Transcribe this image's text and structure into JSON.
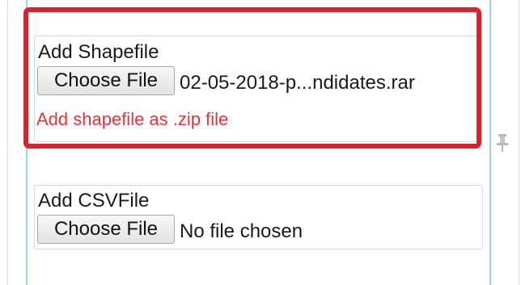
{
  "shapefile": {
    "label": "Add Shapefile",
    "button_label": "Choose File",
    "file_name": "02-05-2018-p...ndidates.rar",
    "hint": "Add shapefile as .zip file"
  },
  "csvfile": {
    "label": "Add CSVFile",
    "button_label": "Choose File",
    "file_name": "No file chosen"
  },
  "colors": {
    "highlight": "#d9222a",
    "hint": "#e8323c",
    "panel_border": "#9fd1e8"
  },
  "icons": {
    "pin": "pin-icon"
  }
}
